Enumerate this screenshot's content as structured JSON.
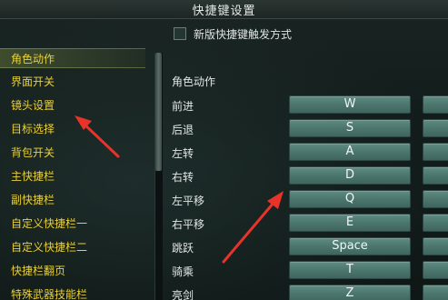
{
  "window": {
    "title": "快捷键设置"
  },
  "top_option": {
    "label": "新版快捷键触发方式",
    "checked": false
  },
  "sidebar": {
    "items": [
      {
        "label": "角色动作",
        "active": true
      },
      {
        "label": "界面开关"
      },
      {
        "label": "镜头设置"
      },
      {
        "label": "目标选择"
      },
      {
        "label": "背包开关"
      },
      {
        "label": "主快捷栏"
      },
      {
        "label": "副快捷栏"
      },
      {
        "label": "自定义快捷栏一"
      },
      {
        "label": "自定义快捷栏二"
      },
      {
        "label": "快捷栏翻页"
      },
      {
        "label": "特殊武器技能栏"
      }
    ]
  },
  "content": {
    "section_title": "角色动作",
    "rows": [
      {
        "action": "前进",
        "key": "W"
      },
      {
        "action": "后退",
        "key": "S"
      },
      {
        "action": "左转",
        "key": "A"
      },
      {
        "action": "右转",
        "key": "D"
      },
      {
        "action": "左平移",
        "key": "Q"
      },
      {
        "action": "右平移",
        "key": "E"
      },
      {
        "action": "跳跃",
        "key": "Space"
      },
      {
        "action": "骑乘",
        "key": "T"
      },
      {
        "action": "亮剑",
        "key": "Z"
      }
    ]
  },
  "colors": {
    "sidebar_text": "#e8cf3a",
    "key_button": "#4b766e",
    "annotation_arrow": "#e8332a"
  }
}
